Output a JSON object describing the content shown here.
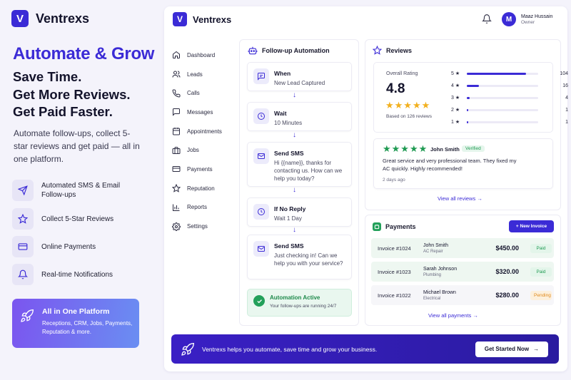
{
  "brand": {
    "name": "Ventrexs",
    "logo_letter": "V"
  },
  "hero": {
    "headline": "Automate & Grow",
    "lines": [
      "Save Time.",
      "Get More Reviews.",
      "Get Paid Faster."
    ],
    "description": "Automate follow-ups, collect 5-star reviews and get paid — all in one platform."
  },
  "features": [
    {
      "icon": "send-icon",
      "label": "Automated SMS & Email Follow-ups"
    },
    {
      "icon": "star-icon",
      "label": "Collect 5-Star Reviews"
    },
    {
      "icon": "card-icon",
      "label": "Online Payments"
    },
    {
      "icon": "bell-icon",
      "label": "Real-time Notifications"
    }
  ],
  "promo": {
    "title": "All in One Platform",
    "desc": "Receptions, CRM, Jobs, Payments, Reputation & more."
  },
  "user": {
    "initial": "M",
    "name": "Maaz Hussain",
    "role": "Owner"
  },
  "nav": [
    "Dashboard",
    "Leads",
    "Calls",
    "Messages",
    "Appointments",
    "Jobs",
    "Payments",
    "Reputation",
    "Reports",
    "Settings"
  ],
  "followup": {
    "title": "Follow-up Automation",
    "steps": [
      {
        "icon": "chat-icon",
        "title": "When",
        "desc": "New Lead Captured"
      },
      {
        "icon": "clock-icon",
        "title": "Wait",
        "desc": "10 Minutes"
      },
      {
        "icon": "mail-icon",
        "title": "Send SMS",
        "desc": "Hi {{name}}, thanks for contacting us. How can we help you today?"
      },
      {
        "icon": "clock-icon",
        "title": "If No Reply",
        "desc": "Wait 1 Day"
      },
      {
        "icon": "mail-icon",
        "title": "Send SMS",
        "desc": "Just checking in! Can we help you with your service?"
      }
    ],
    "arrow": "↓",
    "active_title": "Automation Active",
    "active_desc": "Your follow-ups are running 24/7"
  },
  "reviews": {
    "title": "Reviews",
    "overall_label": "Overall Rating",
    "rating": "4.8",
    "stars": "★★★★★",
    "based_on": "Based on 126 reviews",
    "breakdown": [
      {
        "label": "5 ★",
        "count": "104",
        "fraction": 0.83
      },
      {
        "label": "4 ★",
        "count": "16",
        "fraction": 0.17
      },
      {
        "label": "3 ★",
        "count": "4",
        "fraction": 0.04
      },
      {
        "label": "2 ★",
        "count": "1",
        "fraction": 0.01
      },
      {
        "label": "1 ★",
        "count": "1",
        "fraction": 0.01
      }
    ],
    "review": {
      "stars": "★★★★★",
      "author": "John Smith",
      "verified": "Verified",
      "text": "Great service and very professional team. They fixed my AC quickly. Highly recommended!",
      "date": "2 days ago"
    },
    "view_all": "View all reviews"
  },
  "payments": {
    "title": "Payments",
    "new_invoice": "+ New Invoice",
    "invoices": [
      {
        "id": "Invoice #1024",
        "name": "John Smith",
        "service": "AC Repair",
        "amount": "$450.00",
        "status": "Paid",
        "status_color": "#1f9a52",
        "status_bg": "#e3f5ea",
        "row_bg": "#eef7f1"
      },
      {
        "id": "Invoice #1023",
        "name": "Sarah Johnson",
        "service": "Plumbing",
        "amount": "$320.00",
        "status": "Paid",
        "status_color": "#1f9a52",
        "status_bg": "#e3f5ea",
        "row_bg": "#eef7f1"
      },
      {
        "id": "Invoice #1022",
        "name": "Michael Brown",
        "service": "Electrical",
        "amount": "$280.00",
        "status": "Pending",
        "status_color": "#e08a1e",
        "status_bg": "#fdf0dc",
        "row_bg": "#f6f6f9"
      }
    ],
    "view_all": "View all payments"
  },
  "cta": {
    "text": "Ventrexs helps you automate, save time and grow your business.",
    "button": "Get Started Now"
  },
  "colors": {
    "accent": "#3b2bd6",
    "success": "#1f9a52",
    "star": "#f2b01e"
  }
}
